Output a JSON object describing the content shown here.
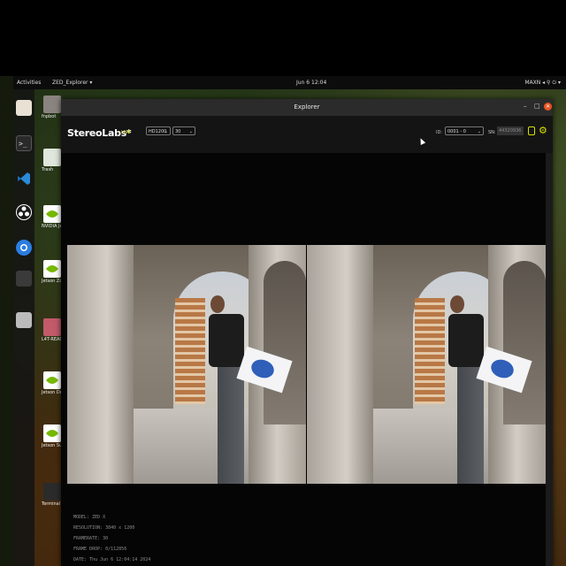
{
  "topbar": {
    "activities": "Activities",
    "app_menu": "ZED_Explorer ▾",
    "clock": "Jun 6  12:04",
    "tray": "MAXN  ◂ ⚲ ⏻ ▾"
  },
  "desktop_icons": [
    {
      "label": "fnpbot",
      "icon": "folder-icon"
    },
    {
      "label": "Trash",
      "icon": "trash-icon"
    },
    {
      "label": "NVIDIA Jetson Community P",
      "icon": "nvidia-icon"
    },
    {
      "label": "Jetson Zoo",
      "icon": "nvidia-icon"
    },
    {
      "label": "L4T-READM",
      "icon": "folder-icon"
    },
    {
      "label": "Jetson Developer Z",
      "icon": "nvidia-icon"
    },
    {
      "label": "Jetson Supp Forums",
      "icon": "nvidia-icon"
    },
    {
      "label": "Terminal",
      "icon": "terminal-icon"
    }
  ],
  "window": {
    "title": "Explorer",
    "minimize": "–",
    "maximize": "□",
    "close": "✕"
  },
  "appbar": {
    "brand": "StereoLabs*",
    "live": "LIVE",
    "resolution": "HD1200",
    "fps": "30",
    "id_label": "ID:",
    "id_value": "0001 - 0",
    "sn_label": "SN:",
    "sn_value": "44320936"
  },
  "info": {
    "model": "MODEL: ZED X",
    "resolution": "RESOLUTION: 3840 x 1200",
    "framerate": "FRAMERATE: 30",
    "frame_drop": "FRAME DROP: 0/112856",
    "date": "DATE: Thu Jun 6 12:04:14 2024"
  },
  "colors": {
    "accent_yellow": "#d6e000",
    "ubuntu_orange": "#e95420",
    "live_green": "#c8d400"
  }
}
